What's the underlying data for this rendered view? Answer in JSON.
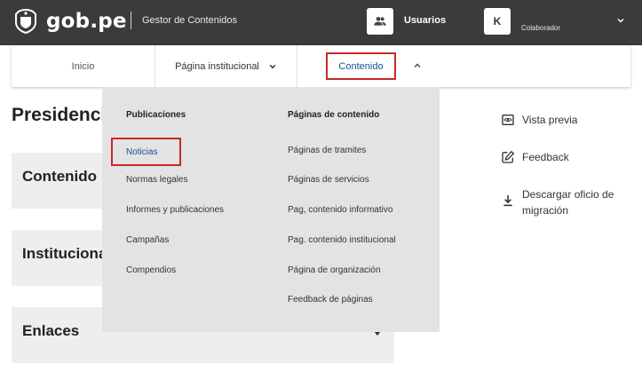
{
  "header": {
    "brand": "gob.pe",
    "subtitle": "Gestor de Contenidos",
    "users_label": "Usuarios",
    "avatar_initial": "K",
    "role": "Colaborador"
  },
  "nav": {
    "items": [
      {
        "label": "Inicio"
      },
      {
        "label": "Página institucional"
      },
      {
        "label": "Contenido"
      }
    ]
  },
  "page": {
    "title": "Presidencia",
    "sections": [
      {
        "label": "Contenido"
      },
      {
        "label": "Institucional"
      },
      {
        "label": "Enlaces"
      }
    ]
  },
  "actions": [
    {
      "label": "Vista previa",
      "icon": "eye-icon"
    },
    {
      "label": "Feedback",
      "icon": "edit-icon"
    },
    {
      "label": "Descargar oficio de migración",
      "icon": "download-icon"
    }
  ],
  "dropdown": {
    "col1": {
      "heading": "Publicaciones",
      "items": [
        "Noticias",
        "Normas legales",
        "Informes y publicaciones",
        "Campañas",
        "Compendios"
      ]
    },
    "col2": {
      "heading": "Páginas de contenido",
      "items": [
        "Páginas de tramites",
        "Páginas de servicios",
        "Pag, contenido informativo",
        "Pag. contenido institucional",
        "Página de organización",
        "Feedback de páginas"
      ]
    }
  },
  "colors": {
    "topbar": "#3b3b3b",
    "highlight_border": "#c62828",
    "link_blue": "#1a4fa0",
    "dropdown_bg": "#e3e3e3",
    "accordion_bg": "#eeeeee"
  }
}
